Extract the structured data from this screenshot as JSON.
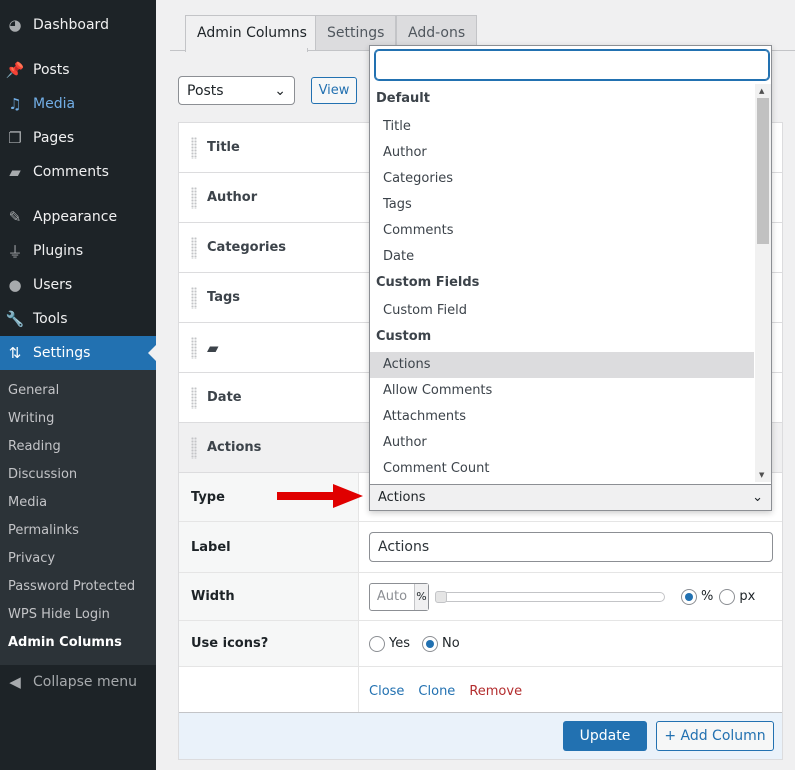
{
  "sidebar": {
    "menu": [
      {
        "label": "Dashboard",
        "icon": "dashboard-icon"
      },
      {
        "label": "Posts",
        "icon": "pin-icon"
      },
      {
        "label": "Media",
        "icon": "media-icon"
      },
      {
        "label": "Pages",
        "icon": "pages-icon"
      },
      {
        "label": "Comments",
        "icon": "comment-icon"
      },
      {
        "label": "Appearance",
        "icon": "brush-icon"
      },
      {
        "label": "Plugins",
        "icon": "plugin-icon"
      },
      {
        "label": "Users",
        "icon": "user-icon"
      },
      {
        "label": "Tools",
        "icon": "wrench-icon"
      },
      {
        "label": "Settings",
        "icon": "settings-icon"
      }
    ],
    "submenu": [
      "General",
      "Writing",
      "Reading",
      "Discussion",
      "Media",
      "Permalinks",
      "Privacy",
      "Password Protected",
      "WPS Hide Login",
      "Admin Columns"
    ],
    "collapse": "Collapse menu"
  },
  "tabs": [
    "Admin Columns",
    "Settings",
    "Add-ons"
  ],
  "post_type_select": "Posts",
  "view_button": "View",
  "columns": [
    "Title",
    "Author",
    "Categories",
    "Tags",
    "",
    "Date",
    "Actions"
  ],
  "settings": {
    "type_label": "Type",
    "type_value": "Actions",
    "label_label": "Label",
    "label_value": "Actions",
    "width_label": "Width",
    "width_placeholder": "Auto",
    "width_unit": "%",
    "unit_percent": "%",
    "unit_px": "px",
    "width_value_percent": 0,
    "icons_label": "Use icons?",
    "yes": "Yes",
    "no": "No",
    "close": "Close",
    "clone": "Clone",
    "remove": "Remove"
  },
  "footer": {
    "update": "Update",
    "add_column": "+ Add Column"
  },
  "dropdown": {
    "search_value": "",
    "groups": [
      {
        "label": "Default",
        "items": [
          "Title",
          "Author",
          "Categories",
          "Tags",
          "Comments",
          "Date"
        ]
      },
      {
        "label": "Custom Fields",
        "items": [
          "Custom Field"
        ]
      },
      {
        "label": "Custom",
        "items": [
          "Actions",
          "Allow Comments",
          "Attachments",
          "Author",
          "Comment Count"
        ]
      }
    ],
    "highlighted": "Actions"
  },
  "colors": {
    "sidebar": "#1d2327",
    "accent": "#2271b1",
    "remove": "#b32d2e",
    "arrow": "#e00000"
  }
}
